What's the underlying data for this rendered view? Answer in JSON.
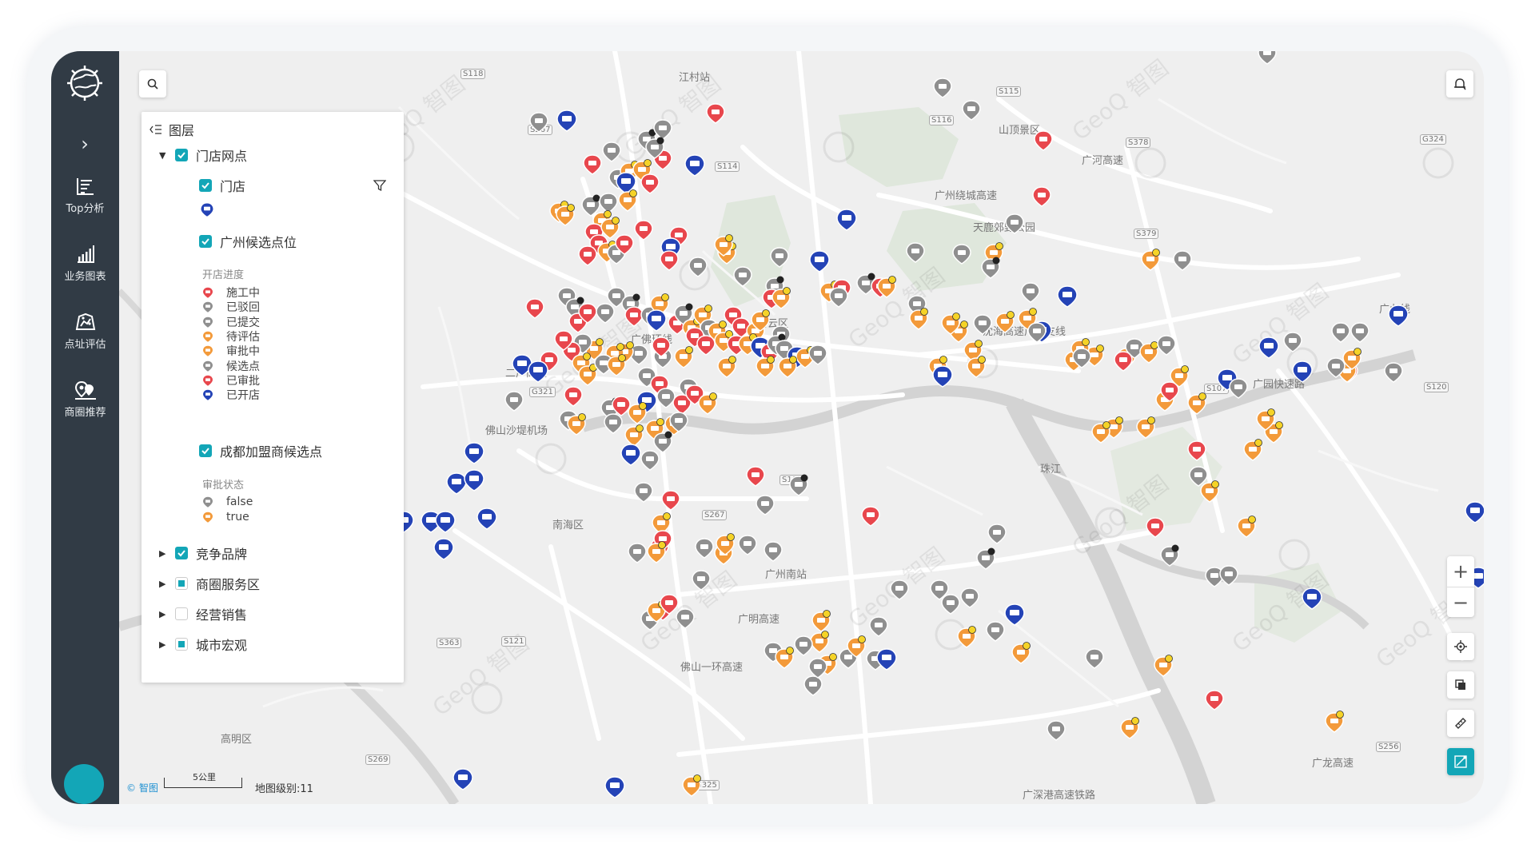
{
  "sidebar": {
    "items": [
      {
        "label": "Top分析",
        "icon": "top-analysis-icon"
      },
      {
        "label": "业务图表",
        "icon": "bar-chart-icon"
      },
      {
        "label": "点址评估",
        "icon": "site-evaluation-icon"
      },
      {
        "label": "商圈推荐",
        "icon": "trade-area-recommend-icon"
      }
    ],
    "collapse_glyph": "›"
  },
  "layer_panel": {
    "title": "图层",
    "groups": [
      {
        "label": "门店网点",
        "state": "checked",
        "expanded": true
      },
      {
        "label": "竞争品牌",
        "state": "checked",
        "expanded": false
      },
      {
        "label": "商圈服务区",
        "state": "partial",
        "expanded": false
      },
      {
        "label": "经营销售",
        "state": "empty",
        "expanded": false
      },
      {
        "label": "城市宏观",
        "state": "partial",
        "expanded": false
      }
    ],
    "sublayers": {
      "store": "门店",
      "guangzhou": "广州候选点位",
      "chengdu": "成都加盟商候选点"
    },
    "progress_title": "开店进度",
    "progress_items": [
      {
        "label": "施工中",
        "color": "#e8474d"
      },
      {
        "label": "已驳回",
        "color": "#8f8f8f"
      },
      {
        "label": "已提交",
        "color": "#8f8f8f"
      },
      {
        "label": "待评估",
        "color": "#f39a3a"
      },
      {
        "label": "审批中",
        "color": "#f39a3a"
      },
      {
        "label": "候选点",
        "color": "#8f8f8f"
      },
      {
        "label": "已审批",
        "color": "#e8474d"
      },
      {
        "label": "已开店",
        "color": "#2443b6"
      }
    ],
    "approval_title": "审批状态",
    "approval_items": [
      {
        "label": "false",
        "color": "#8f8f8f"
      },
      {
        "label": "true",
        "color": "#f39a3a"
      }
    ]
  },
  "map": {
    "places": [
      {
        "name": "江村站"
      },
      {
        "name": "山顶景区"
      },
      {
        "name": "天鹿郊野公园"
      },
      {
        "name": "白云区"
      },
      {
        "name": "二广高速"
      },
      {
        "name": "佛山沙堤机场"
      },
      {
        "name": "广佛环线"
      },
      {
        "name": "南海区"
      },
      {
        "name": "广州南站"
      },
      {
        "name": "高明区"
      },
      {
        "name": "珠江"
      },
      {
        "name": "沈海高速广州支线"
      },
      {
        "name": "广园快速路"
      },
      {
        "name": "广深港高速铁路"
      },
      {
        "name": "广州绕城高速"
      },
      {
        "name": "广龙高速"
      },
      {
        "name": "佛山一环高速"
      },
      {
        "name": "广九线"
      },
      {
        "name": "广河高速"
      },
      {
        "name": "广明高速"
      }
    ],
    "road_shields": [
      "S118",
      "S267",
      "S114",
      "S116",
      "S115",
      "S378",
      "G324",
      "S379",
      "G321",
      "S107",
      "S120",
      "S105",
      "S267",
      "S121",
      "S363",
      "S269",
      "G325",
      "S256"
    ],
    "watermark": "GeoQ 智图",
    "attribution": "智图",
    "scale_label": "5公里",
    "level_text": "地图级别:11"
  },
  "colors": {
    "sidebar_bg": "#313b45",
    "accent": "#13a6b7",
    "red": "#e8474d",
    "orange": "#f39a3a",
    "gray": "#8f8f8f",
    "blue": "#2443b6"
  }
}
